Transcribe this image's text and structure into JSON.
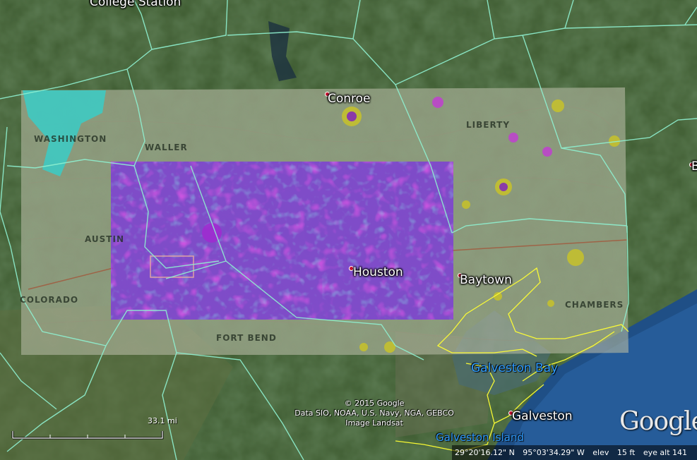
{
  "places": [
    {
      "id": "college-station",
      "label": "College Station"
    },
    {
      "id": "conroe",
      "label": "Conroe"
    },
    {
      "id": "houston",
      "label": "Houston"
    },
    {
      "id": "baytown",
      "label": "Baytown"
    },
    {
      "id": "galveston",
      "label": "Galveston"
    }
  ],
  "edge_label": "B",
  "water": {
    "bay": "Galveston Bay",
    "island": "Galveston Island"
  },
  "overlay_county_labels": [
    "WASHINGTON",
    "WALLER",
    "AUSTIN",
    "COLORADO",
    "FORT BEND",
    "LIBERTY",
    "CHAMBERS"
  ],
  "attribution": {
    "line1": "© 2015 Google",
    "line2": "Data SIO, NOAA, U.S. Navy, NGA, GEBCO",
    "line3": "Image Landsat"
  },
  "scale_bar": {
    "label": "33.1 mi"
  },
  "logo": {
    "text": "Google"
  },
  "status": {
    "lat": "29°20'16.12\" N",
    "lon": "95°03'34.29\" W",
    "elev_label": "elev",
    "elev_value": "15 ft",
    "eye_alt": "eye alt 141"
  },
  "colors": {
    "county_border": "#8ff0d0",
    "coastline": "#ffff33",
    "radar_overlay": "#8a2be2",
    "city_dot": "#c8102e",
    "water_label": "#2f9cff"
  }
}
